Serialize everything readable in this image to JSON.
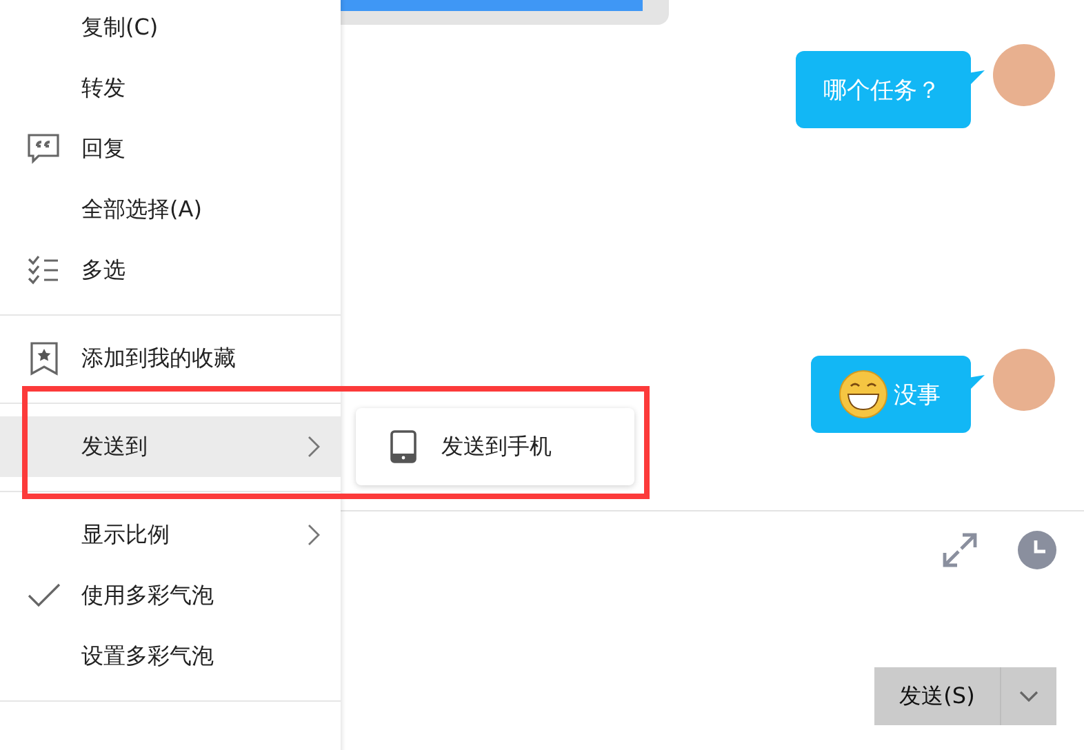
{
  "chat": {
    "messages": [
      {
        "text": "哪个任务？",
        "emoji": false
      },
      {
        "text": "没事",
        "emoji": true
      }
    ]
  },
  "context_menu": {
    "items": [
      {
        "kind": "item",
        "label": "复制(C)",
        "selected": false,
        "checked": false,
        "submenu": false
      },
      {
        "kind": "item",
        "label": "转发",
        "selected": false,
        "checked": false,
        "submenu": false
      },
      {
        "kind": "item",
        "label": "回复",
        "selected": false,
        "checked": false,
        "submenu": false
      },
      {
        "kind": "item",
        "label": "全部选择(A)",
        "selected": false,
        "checked": false,
        "submenu": false
      },
      {
        "kind": "item",
        "label": "多选",
        "selected": false,
        "checked": false,
        "submenu": false
      },
      {
        "kind": "divider"
      },
      {
        "kind": "item",
        "label": "添加到我的收藏",
        "selected": false,
        "checked": false,
        "submenu": false
      },
      {
        "kind": "divider"
      },
      {
        "kind": "item",
        "label": "发送到",
        "selected": true,
        "checked": false,
        "submenu": true
      },
      {
        "kind": "divider"
      },
      {
        "kind": "item",
        "label": "显示比例",
        "selected": false,
        "checked": false,
        "submenu": true
      },
      {
        "kind": "item",
        "label": "使用多彩气泡",
        "selected": false,
        "checked": true,
        "submenu": false
      },
      {
        "kind": "item",
        "label": "设置多彩气泡",
        "selected": false,
        "checked": false,
        "submenu": false
      },
      {
        "kind": "divider"
      }
    ]
  },
  "submenu": {
    "items": [
      {
        "label": "发送到手机"
      }
    ]
  },
  "send_button": {
    "label": "发送(S)"
  }
}
